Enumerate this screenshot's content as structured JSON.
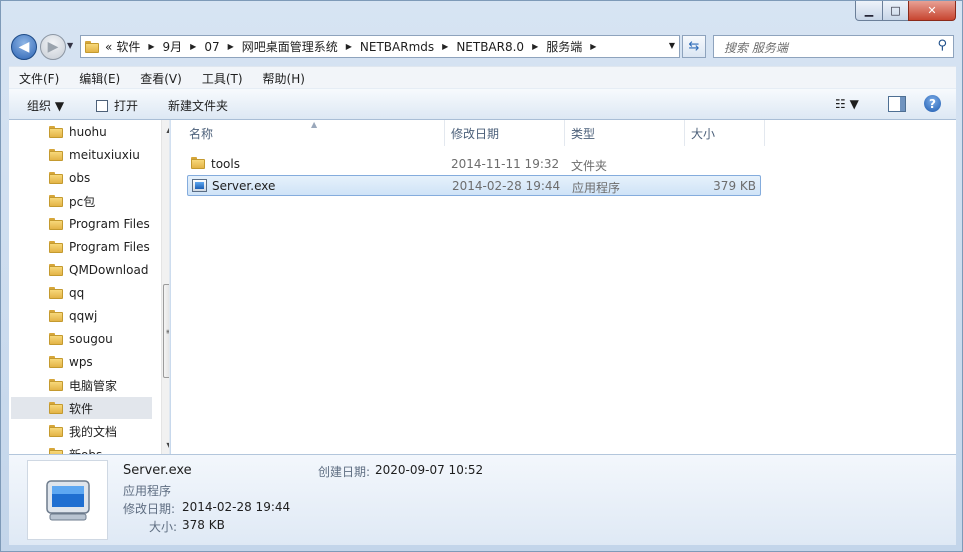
{
  "window": {
    "controls": {
      "minimize": "▁",
      "maximize": "□",
      "close": "✕"
    }
  },
  "nav": {
    "back_glyph": "◀",
    "forward_glyph": "▶",
    "breadcrumb": [
      "«",
      "软件",
      "9月",
      "07",
      "网吧桌面管理系统",
      "NETBARmds",
      "NETBAR8.0",
      "服务端"
    ],
    "search_placeholder": "搜索 服务端"
  },
  "menu": [
    "文件(F)",
    "编辑(E)",
    "查看(V)",
    "工具(T)",
    "帮助(H)"
  ],
  "toolbar": {
    "organize": "组织 ▼",
    "open": "打开",
    "new_folder": "新建文件夹",
    "view": "☷ ▼",
    "help": "?"
  },
  "tree": [
    {
      "label": "huohu"
    },
    {
      "label": "meituxiuxiu"
    },
    {
      "label": "obs"
    },
    {
      "label": "pc包"
    },
    {
      "label": "Program Files"
    },
    {
      "label": "Program Files"
    },
    {
      "label": "QMDownload"
    },
    {
      "label": "qq"
    },
    {
      "label": "qqwj"
    },
    {
      "label": "sougou"
    },
    {
      "label": "wps"
    },
    {
      "label": "电脑管家"
    },
    {
      "label": "软件"
    },
    {
      "label": "我的文档"
    },
    {
      "label": "新obs"
    }
  ],
  "columns": {
    "name": "名称",
    "date": "修改日期",
    "type": "类型",
    "size": "大小"
  },
  "files": [
    {
      "name": "tools",
      "date": "2014-11-11 19:32",
      "type": "文件夹",
      "size": ""
    },
    {
      "name": "Server.exe",
      "date": "2014-02-28 19:44",
      "type": "应用程序",
      "size": "379 KB"
    }
  ],
  "details": {
    "name": "Server.exe",
    "type": "应用程序",
    "modified_label": "修改日期:",
    "modified": "2014-02-28 19:44",
    "size_label": "大小:",
    "size": "378 KB",
    "created_label": "创建日期:",
    "created": "2020-09-07 10:52"
  }
}
